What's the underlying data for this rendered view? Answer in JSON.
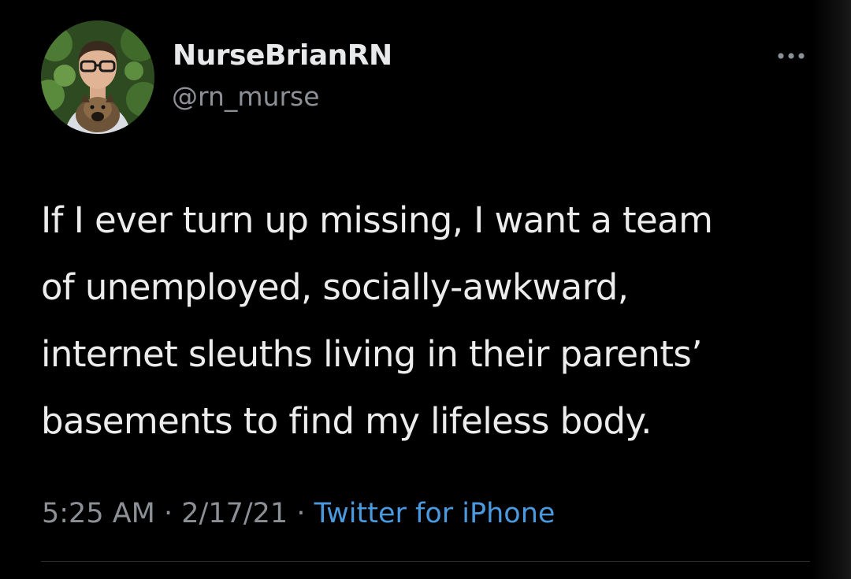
{
  "user": {
    "display_name": "NurseBrianRN",
    "handle": "@rn_murse",
    "avatar_icon": "profile-photo"
  },
  "more_icon": "ellipsis-icon",
  "tweet": {
    "lines": [
      "If I ever turn up missing, I want a team",
      "of unemployed, socially-awkward,",
      "internet sleuths living in their parents’",
      "basements to find my lifeless body."
    ]
  },
  "meta": {
    "time": "5:25 AM",
    "separator": " · ",
    "date": "2/17/21",
    "source": "Twitter for iPhone"
  },
  "colors": {
    "background": "#000000",
    "text": "#e7e9ea",
    "secondary": "#8b9096",
    "link": "#4a9ae0"
  }
}
